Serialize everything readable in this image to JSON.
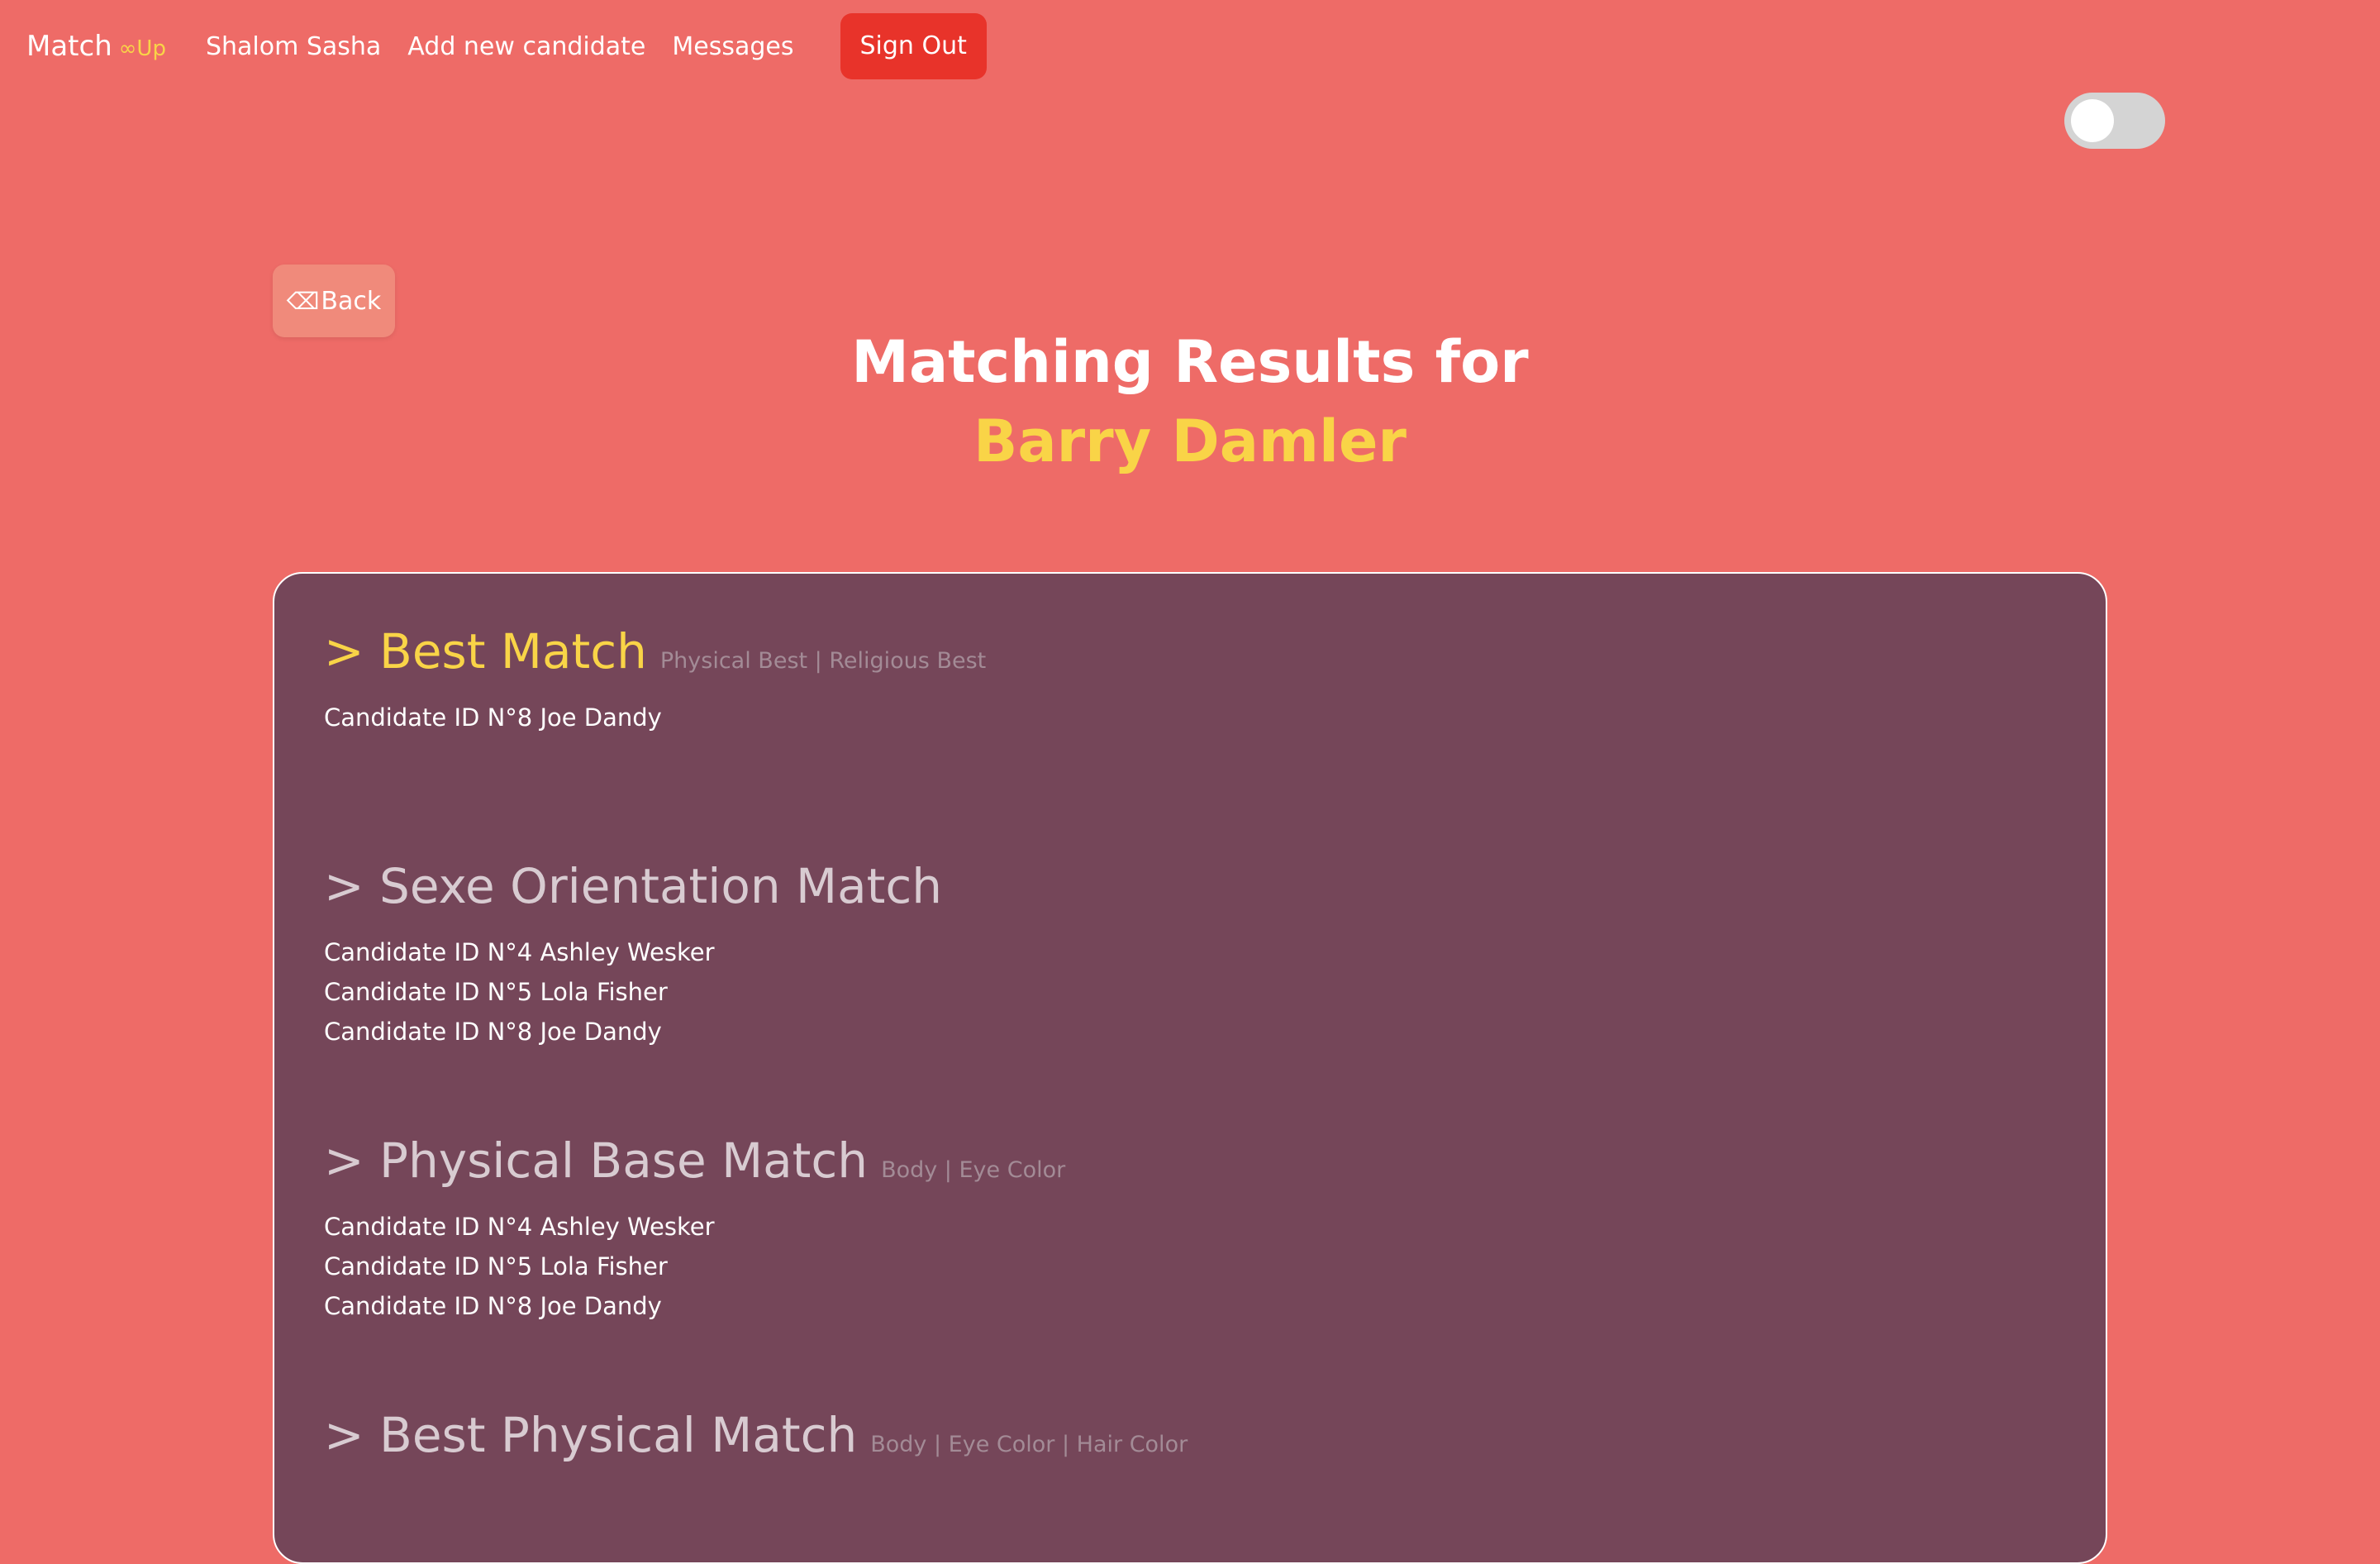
{
  "navbar": {
    "brand": "Match",
    "brand_sub": "∞Up",
    "links": [
      "Shalom Sasha",
      "Add new candidate",
      "Messages"
    ],
    "sign_out": "Sign Out"
  },
  "toggle": {
    "state": "off"
  },
  "back_button": {
    "icon": "backspace-icon",
    "label": "Back"
  },
  "title": {
    "line1": "Matching Results for",
    "candidate_name": "Barry Damler"
  },
  "colors": {
    "background": "#ee6b67",
    "accent": "#f9d447",
    "card": "#754659",
    "sign_out": "#e8332a"
  },
  "sections": [
    {
      "title": "> Best Match",
      "subtitle": "Physical Best | Religious Best",
      "candidates": [
        "Candidate ID N°8 Joe Dandy"
      ]
    },
    {
      "title": "> Sexe Orientation Match",
      "subtitle": "",
      "candidates": [
        "Candidate ID N°4 Ashley Wesker",
        "Candidate ID N°5 Lola Fisher",
        "Candidate ID N°8 Joe Dandy"
      ]
    },
    {
      "title": "> Physical Base Match",
      "subtitle": "Body | Eye Color",
      "candidates": [
        "Candidate ID N°4 Ashley Wesker",
        "Candidate ID N°5 Lola Fisher",
        "Candidate ID N°8 Joe Dandy"
      ]
    },
    {
      "title": "> Best Physical Match",
      "subtitle": "Body | Eye Color | Hair Color",
      "candidates": []
    }
  ]
}
